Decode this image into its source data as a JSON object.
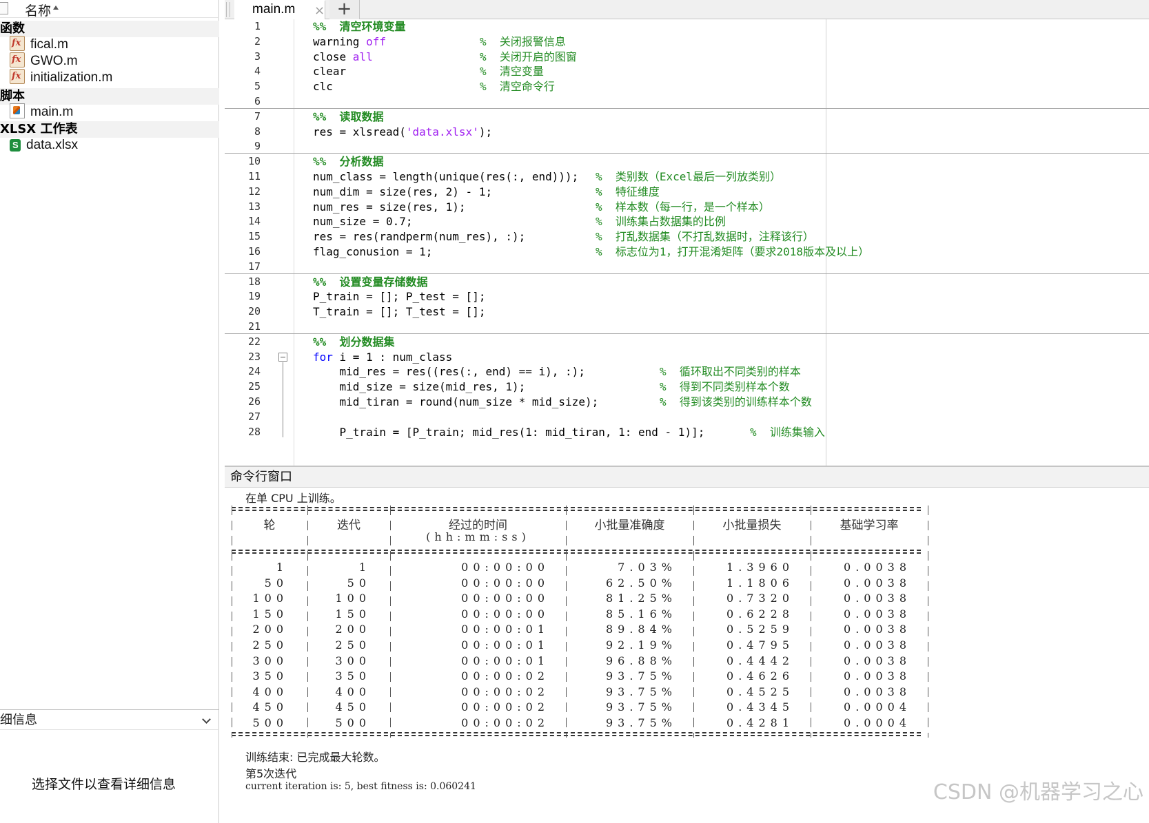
{
  "file_browser": {
    "header_label": "名称",
    "groups": [
      {
        "label": "函数",
        "items": [
          "fical.m",
          "GWO.m",
          "initialization.m"
        ]
      },
      {
        "label": "脚本",
        "items": [
          "main.m"
        ]
      },
      {
        "label": "XLSX 工作表",
        "items": [
          "data.xlsx"
        ]
      }
    ],
    "details_label": "细信息",
    "details_message": "选择文件以查看详细信息"
  },
  "editor": {
    "tab_label": "main.m",
    "add_tab": "+",
    "close_glyph": "×",
    "lines": [
      {
        "n": "1",
        "sec": "%%  清空环境变量"
      },
      {
        "n": "2",
        "code": "warning off",
        "cmt": "%  关闭报警信息",
        "cmtx": 342
      },
      {
        "n": "3",
        "code": "close all",
        "cmt": "%  关闭开启的图窗",
        "cmtx": 342
      },
      {
        "n": "4",
        "code": "clear",
        "cmt": "%  清空变量",
        "cmtx": 342
      },
      {
        "n": "5",
        "code": "clc",
        "cmt": "%  清空命令行",
        "cmtx": 342
      },
      {
        "n": "6"
      },
      {
        "n": "7",
        "sec": "%%  读取数据"
      },
      {
        "n": "8",
        "code": "res = xlsread('data.xlsx');"
      },
      {
        "n": "9"
      },
      {
        "n": "10",
        "sec": "%%  分析数据"
      },
      {
        "n": "11",
        "code": "num_class = length(unique(res(:, end)));",
        "cmt": "%  类别数（Excel最后一列放类别）",
        "cmtx": 510
      },
      {
        "n": "12",
        "code": "num_dim = size(res, 2) - 1;",
        "cmt": "%  特征维度",
        "cmtx": 510
      },
      {
        "n": "13",
        "code": "num_res = size(res, 1);",
        "cmt": "%  样本数（每一行，是一个样本）",
        "cmtx": 510
      },
      {
        "n": "14",
        "code": "num_size = 0.7;",
        "cmt": "%  训练集占数据集的比例",
        "cmtx": 510
      },
      {
        "n": "15",
        "code": "res = res(randperm(num_res), :);",
        "cmt": "%  打乱数据集（不打乱数据时，注释该行）",
        "cmtx": 510
      },
      {
        "n": "16",
        "code": "flag_conusion = 1;",
        "cmt": "%  标志位为1，打开混淆矩阵（要求2018版本及以上）",
        "cmtx": 510
      },
      {
        "n": "17"
      },
      {
        "n": "18",
        "sec": "%%  设置变量存储数据"
      },
      {
        "n": "19",
        "code": "P_train = []; P_test = [];"
      },
      {
        "n": "20",
        "code": "T_train = []; T_test = [];"
      },
      {
        "n": "21"
      },
      {
        "n": "22",
        "sec": "%%  划分数据集"
      },
      {
        "n": "23",
        "code": "for i = 1 : num_class"
      },
      {
        "n": "24",
        "code": "    mid_res = res((res(:, end) == i), :);",
        "cmt": "%  循环取出不同类别的样本",
        "cmtx": 603
      },
      {
        "n": "25",
        "code": "    mid_size = size(mid_res, 1);",
        "cmt": "%  得到不同类别样本个数",
        "cmtx": 603
      },
      {
        "n": "26",
        "code": "    mid_tiran = round(num_size * mid_size);",
        "cmt": "%  得到该类别的训练样本个数",
        "cmtx": 603
      },
      {
        "n": "27"
      },
      {
        "n": "28",
        "code": "    P_train = [P_train; mid_res(1: mid_tiran, 1: end - 1)];",
        "cmt": "%  训练集输入",
        "cmtx": 734
      }
    ]
  },
  "command_window": {
    "title": "命令行窗口",
    "intro": "在单 CPU 上训练。",
    "columns": [
      "轮",
      "迭代",
      "经过的时间",
      "小批量准确度",
      "小批量损失",
      "基础学习率"
    ],
    "time_unit": "(hh:mm:ss)",
    "rows": [
      [
        "1",
        "1",
        "00:00:00",
        "7.03%",
        "1.3960",
        "0.0038"
      ],
      [
        "50",
        "50",
        "00:00:00",
        "62.50%",
        "1.1806",
        "0.0038"
      ],
      [
        "100",
        "100",
        "00:00:00",
        "81.25%",
        "0.7320",
        "0.0038"
      ],
      [
        "150",
        "150",
        "00:00:00",
        "85.16%",
        "0.6228",
        "0.0038"
      ],
      [
        "200",
        "200",
        "00:00:01",
        "89.84%",
        "0.5259",
        "0.0038"
      ],
      [
        "250",
        "250",
        "00:00:01",
        "92.19%",
        "0.4795",
        "0.0038"
      ],
      [
        "300",
        "300",
        "00:00:01",
        "96.88%",
        "0.4442",
        "0.0038"
      ],
      [
        "350",
        "350",
        "00:00:02",
        "93.75%",
        "0.4626",
        "0.0038"
      ],
      [
        "400",
        "400",
        "00:00:02",
        "93.75%",
        "0.4525",
        "0.0038"
      ],
      [
        "450",
        "450",
        "00:00:02",
        "93.75%",
        "0.4345",
        "0.0004"
      ],
      [
        "500",
        "500",
        "00:00:02",
        "93.75%",
        "0.4281",
        "0.0004"
      ]
    ],
    "finish_msg": "训练结束: 已完成最大轮数。",
    "iter_msg": "第5次迭代",
    "fitness_msg": "current iteration is: 5, best fitness is: 0.060241"
  },
  "watermark": "CSDN @机器学习之心"
}
